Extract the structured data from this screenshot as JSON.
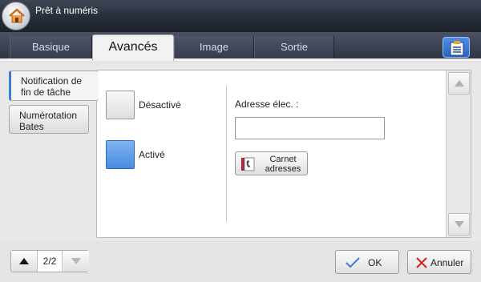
{
  "app": {
    "title": "Prêt à numéris"
  },
  "tabs": [
    {
      "label": "Basique"
    },
    {
      "label": "Avancés"
    },
    {
      "label": "Image"
    },
    {
      "label": "Sortie"
    }
  ],
  "active_tab": "Avancés",
  "sidebar": {
    "items": [
      {
        "line1": "Notification de",
        "line2": "fin de tâche"
      },
      {
        "line1": "Numérotation",
        "line2": "Bates"
      }
    ]
  },
  "options": {
    "off_label": "Désactivé",
    "on_label": "Activé",
    "selected": "Activé"
  },
  "email": {
    "label": "Adresse élec. :",
    "value": "",
    "placeholder": ""
  },
  "address_book": {
    "line1": "Carnet",
    "line2": "adresses"
  },
  "pager": {
    "text": "2/2"
  },
  "buttons": {
    "ok": "OK",
    "cancel": "Annuler"
  },
  "colors": {
    "accent": "#4a8be0",
    "titlebar": "#252b37",
    "cancel_x": "#d42a2a",
    "ok_check": "#3b7fd4"
  },
  "icons": {
    "home": "home-icon",
    "job_settings": "clipboard-icon",
    "address_book": "phonebook-icon",
    "scroll_up": "triangle-up-icon",
    "scroll_down": "triangle-down-icon",
    "ok": "check-icon",
    "cancel": "x-icon"
  }
}
